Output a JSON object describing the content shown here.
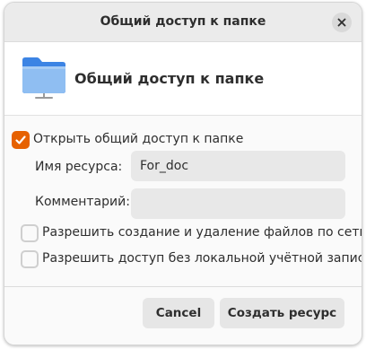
{
  "window": {
    "title": "Общий доступ к папке"
  },
  "header": {
    "icon": "folder-network-icon",
    "heading": "Общий доступ к папке"
  },
  "share_checkbox": {
    "label": "Открыть общий доступ к папке",
    "checked": true
  },
  "fields": {
    "share_name_label": "Имя ресурса:",
    "share_name_value": "For_doc",
    "comment_label": "Комментарий:",
    "comment_value": ""
  },
  "options": [
    {
      "label": "Разрешить создание и удаление файлов по сети",
      "checked": false
    },
    {
      "label": "Разрешить доступ без локальной учётной записи",
      "checked": false
    }
  ],
  "buttons": {
    "cancel": "Cancel",
    "create": "Создать ресурс"
  },
  "colors": {
    "accent": "#e66100",
    "folder": "#8fbef2"
  }
}
